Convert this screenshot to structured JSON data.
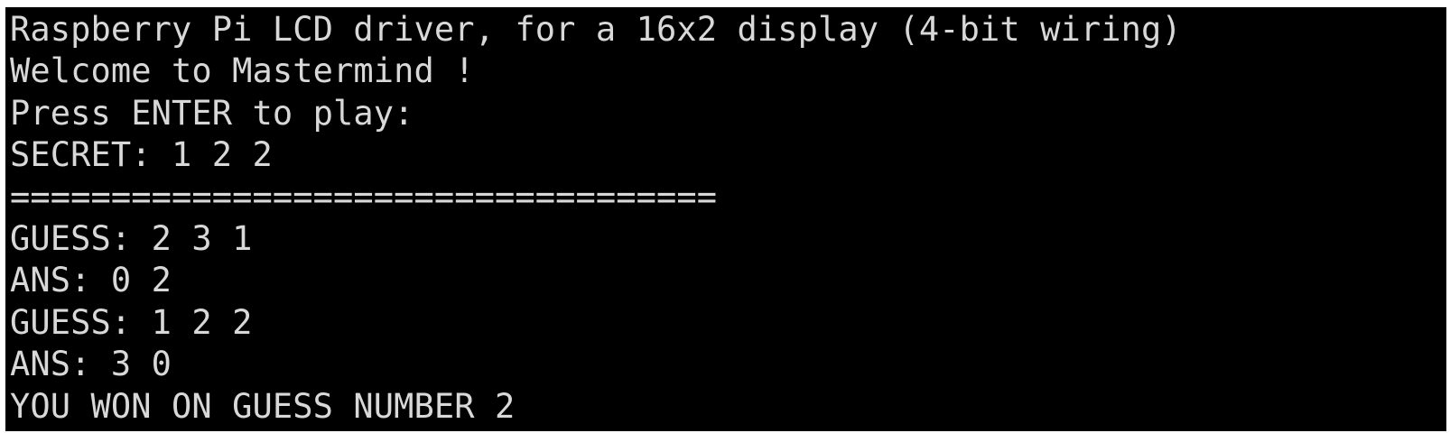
{
  "terminal": {
    "lines": [
      "Raspberry Pi LCD driver, for a 16x2 display (4-bit wiring)",
      "Welcome to Mastermind !",
      "Press ENTER to play:",
      "SECRET: 1 2 2",
      "===================================",
      "GUESS: 2 3 1",
      "ANS: 0 2",
      "GUESS: 1 2 2",
      "ANS: 3 0",
      "YOU WON ON GUESS NUMBER 2"
    ]
  },
  "colors": {
    "background": "#000000",
    "text": "#d8d8d8"
  }
}
